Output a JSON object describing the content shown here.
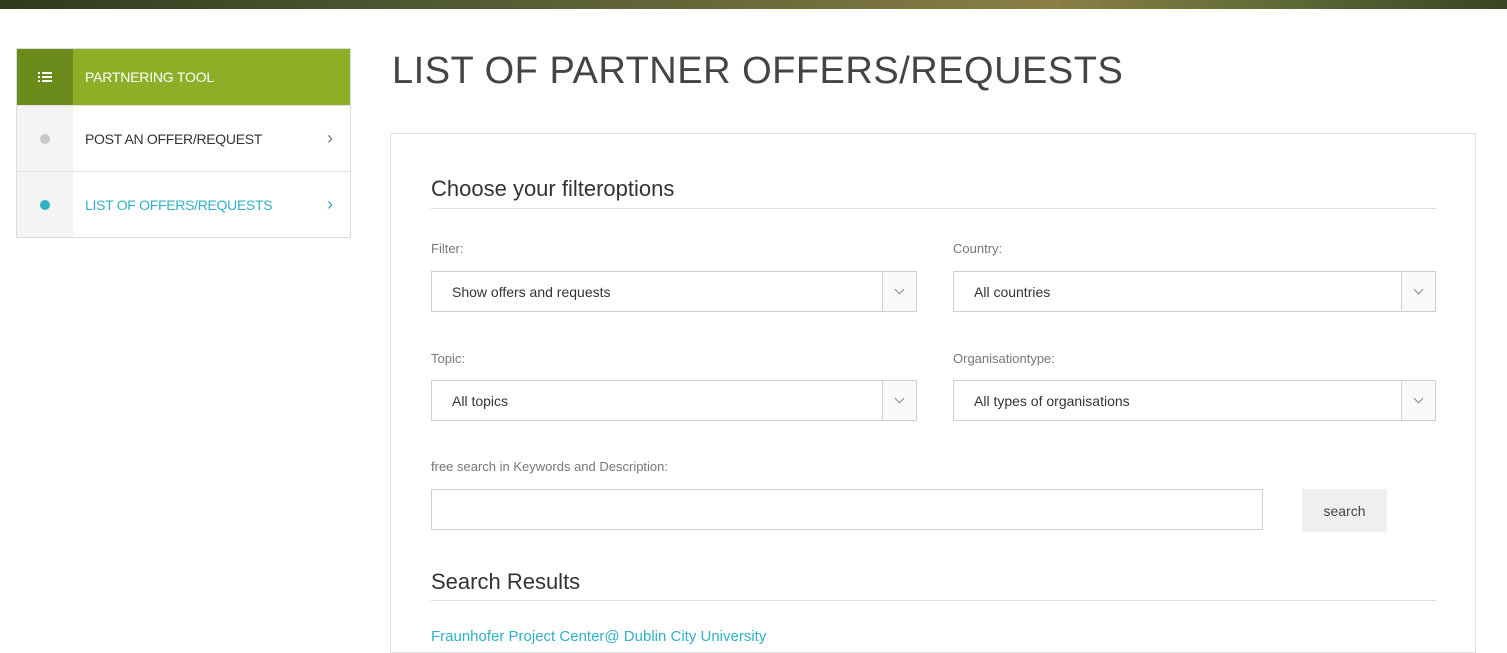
{
  "sidebar": {
    "header": {
      "label": "PARTNERING TOOL",
      "icon": "list-icon"
    },
    "items": [
      {
        "label": "POST AN OFFER/REQUEST",
        "active": false
      },
      {
        "label": "LIST OF OFFERS/REQUESTS",
        "active": true
      }
    ]
  },
  "page": {
    "title": "LIST OF PARTNER OFFERS/REQUESTS"
  },
  "filters": {
    "heading": "Choose your filteroptions",
    "filter": {
      "label": "Filter:",
      "value": "Show offers and requests"
    },
    "country": {
      "label": "Country:",
      "value": "All countries"
    },
    "topic": {
      "label": "Topic:",
      "value": "All topics"
    },
    "organisation": {
      "label": "Organisationtype:",
      "value": "All types of organisations"
    },
    "freesearch": {
      "label": "free search in Keywords and Description:",
      "value": ""
    },
    "search_button": "search"
  },
  "results": {
    "heading": "Search Results",
    "first_item": "Fraunhofer Project Center@ Dublin City University"
  },
  "colors": {
    "accent_green": "#8dae27",
    "accent_teal": "#2fb1c6"
  }
}
